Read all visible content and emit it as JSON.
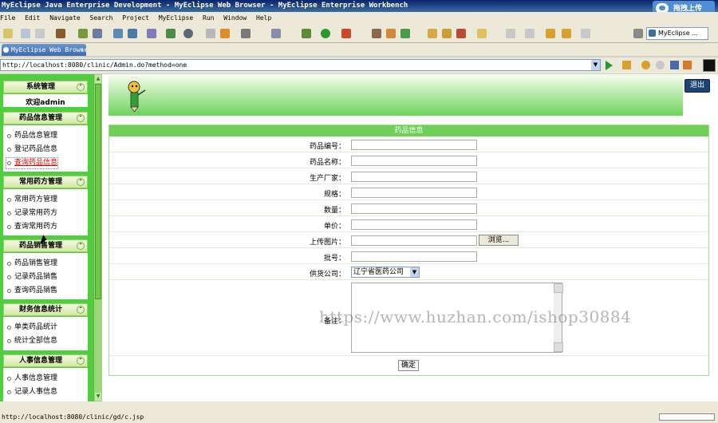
{
  "window": {
    "title": "MyEclipse Java Enterprise Development - MyEclipse Web Browser - MyEclipse Enterprise Workbench",
    "upload_label": "拖拽上传"
  },
  "menubar": [
    "File",
    "Edit",
    "Navigate",
    "Search",
    "Project",
    "MyEclipse",
    "Run",
    "Window",
    "Help"
  ],
  "toolbar": {
    "perspective": "MyEclipse ..."
  },
  "editor_tab": {
    "label": "MyEclipse Web Browser",
    "close": "×"
  },
  "address": {
    "url": "http://localhost:8080/clinic/Admin.do?method=one"
  },
  "sidebar": {
    "sections": [
      {
        "title": "系统管理",
        "welcome": "欢迎admin",
        "items": []
      },
      {
        "title": "药品信息管理",
        "items": [
          "药品信息管理",
          "登记药品信息",
          "查询药品信息"
        ]
      },
      {
        "title": "常用药方管理",
        "items": [
          "常用药方管理",
          "记录常用药方",
          "查询常用药方"
        ]
      },
      {
        "title": "药品销售管理",
        "items": [
          "药品销售管理",
          "记录药品销售",
          "查询药品销售"
        ]
      },
      {
        "title": "财务信息统计",
        "items": [
          "单类药品统计",
          "统计全部信息"
        ]
      },
      {
        "title": "人事信息管理",
        "items": [
          "人事信息管理",
          "记录人事信息"
        ]
      }
    ],
    "collapse_glyph": "⌃"
  },
  "header": {
    "logout_label": "退出"
  },
  "form": {
    "title": "药品信息",
    "fields": [
      {
        "label": "药品编号：",
        "value": ""
      },
      {
        "label": "药品名称：",
        "value": ""
      },
      {
        "label": "生产厂家：",
        "value": ""
      },
      {
        "label": "规格：",
        "value": ""
      },
      {
        "label": "数量：",
        "value": ""
      },
      {
        "label": "单价：",
        "value": ""
      },
      {
        "label": "上传图片：",
        "value": ""
      },
      {
        "label": "批号：",
        "value": ""
      }
    ],
    "browse_label": "浏览...",
    "supplier_label": "供货公司：",
    "supplier_value": "辽宁省医药公司",
    "remark_label": "备注：",
    "confirm_label": "确定"
  },
  "watermark": "https://www.huzhan.com/ishop30884",
  "status": {
    "text": "http://localhost:8080/clinic/gd/c.jsp"
  },
  "colors": {
    "sidebar_green": "#4fcf3e",
    "form_header": "#6fcf57",
    "logout": "#1d4373",
    "highlight_link": "#dd0000"
  }
}
